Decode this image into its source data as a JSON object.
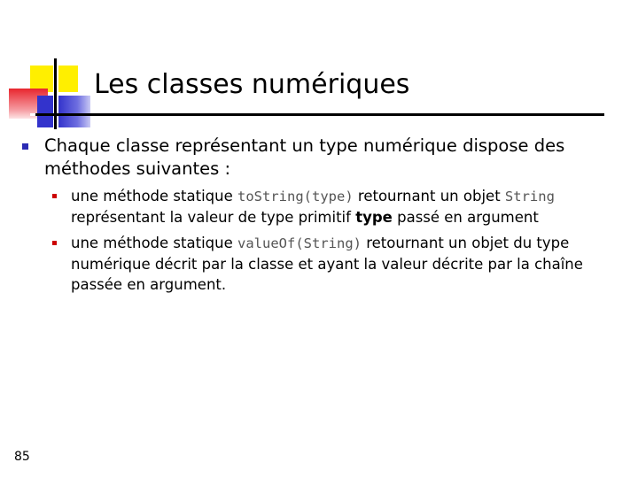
{
  "title": "Les classes numériques",
  "bullet_main": "Chaque classe représentant un type numérique dispose des méthodes suivantes :",
  "sub_items": [
    {
      "part1": "une méthode statique ",
      "code1": "toString(type)",
      "part2": " retournant un objet ",
      "code2": "String",
      "part3": " représentant la valeur de type primitif ",
      "bold": "type",
      "part4": " passé en argument"
    },
    {
      "part1": "une méthode statique ",
      "code1": "valueOf(String)",
      "part2": " retournant un objet du type numérique décrit par la classe et ayant la valeur décrite par la chaîne passée en argument."
    }
  ],
  "page_number": "85",
  "colors": {
    "logo_yellow": "#ffef00",
    "logo_red": "#e8262e",
    "logo_blue": "#3333cc",
    "main_bullet": "#2b2bb4",
    "sub_bullet": "#cc0000"
  }
}
